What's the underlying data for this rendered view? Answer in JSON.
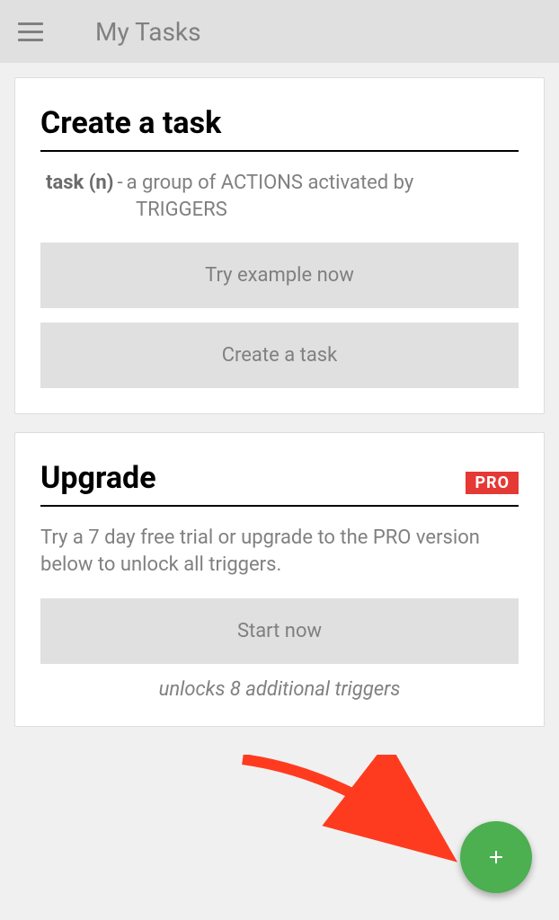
{
  "header": {
    "title": "My Tasks"
  },
  "cards": {
    "create": {
      "title": "Create a task",
      "definition_term": "task (n)",
      "definition_sep": "-",
      "definition_body_line1": "a group of ACTIONS activated by",
      "definition_body_line2": "TRIGGERS",
      "buttons": {
        "try_example": "Try example now",
        "create_task": "Create a task"
      }
    },
    "upgrade": {
      "title": "Upgrade",
      "badge": "PRO",
      "description": "Try a 7 day free trial or upgrade to the PRO version below to unlock all triggers.",
      "start_button": "Start now",
      "note": "unlocks 8 additional triggers"
    }
  },
  "fab": {
    "label": "Add"
  }
}
